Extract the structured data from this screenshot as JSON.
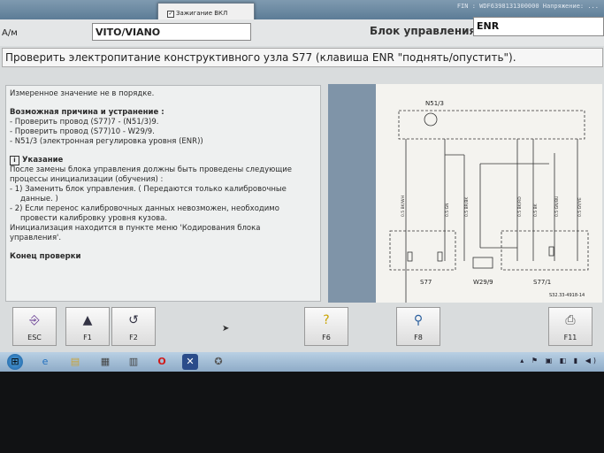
{
  "topbar": {
    "fin": "FIN : WDF6398131300000      Напряжение: ...",
    "ignition_label": "Зажигание ВКЛ"
  },
  "header": {
    "am_label": "А/м",
    "model": "VITO/VIANO",
    "ecu_label": "Блок управления",
    "ecu_value": "ENR"
  },
  "title": "Проверить электропитание конструктивного узла S77 (клавиша ENR \"поднять/опустить\").",
  "panel": {
    "measured": "Измеренное значение не в порядке.",
    "cause_heading": "Возможная причина и устранение :",
    "cause_1": "- Проверить провод (S77)7 - (N51/3)9.",
    "cause_2": "- Проверить провод (S77)10 - W29/9.",
    "cause_3": "- N51/3 (электронная регулировка уровня (ENR))",
    "note_icon": "i",
    "note_heading": "Указание",
    "note_1": "После замены блока управления должны быть проведены следующие",
    "note_2": "процессы инициализации (обучения) :",
    "note_3": "- 1) Заменить блок управления. ( Передаются только калибровочные",
    "note_4": "данные. )",
    "note_5": "- 2) Если перенос калибровочных данных невозможен, необходимо",
    "note_6": "провести калибровку уровня кузова.",
    "note_7": "Инициализация находится в пункте меню 'Кодирования блока",
    "note_8": "управления'.",
    "end": "Конец проверки"
  },
  "diagram": {
    "top_unit": "N51/3",
    "lbl_s77": "S77",
    "lbl_w29": "W29/9",
    "lbl_s771": "S77/1",
    "ref": "S32.33-4918-14",
    "wire_1": "0.5 BK/WH",
    "wire_2": "0.5 GN",
    "wire_3": "0.5 BR/BK",
    "wire_4": "0.5 BK/RD",
    "wire_5": "0.5 BK",
    "wire_6": "0.5 GN/BU",
    "wire_7": "0.5 GY/YE"
  },
  "fkeys": {
    "esc": "ESC",
    "f1": "F1",
    "f2": "F2",
    "f6": "F6",
    "f8": "F8",
    "f11": "F11"
  },
  "colors": {
    "screen_bg": "#d9dcdd",
    "diagram_frame": "#7f94a8",
    "taskbar": "#9db7d0"
  },
  "icons": {
    "esc": "exit-door-icon",
    "f1": "arrow-up-icon",
    "f2": "u-turn-icon",
    "f6": "help-question-icon",
    "f8": "magnifier-icon",
    "f11": "printer-icon"
  }
}
